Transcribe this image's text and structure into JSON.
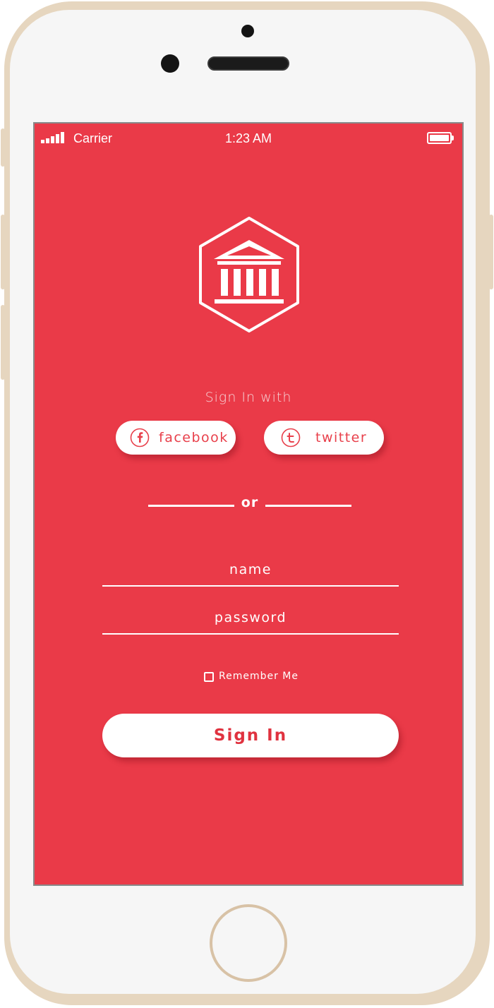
{
  "status_bar": {
    "carrier": "Carrier",
    "time": "1:23 AM",
    "signal_icon": "signal-bars-icon",
    "battery_icon": "battery-full-icon",
    "battery_level": 1.0
  },
  "logo": {
    "icon": "bank-building-hexagon-icon"
  },
  "social": {
    "heading": "Sign In with",
    "facebook_label": "facebook",
    "facebook_icon": "facebook-icon",
    "twitter_label": "twitter",
    "twitter_icon": "twitter-icon"
  },
  "divider": {
    "label": "or"
  },
  "form": {
    "name_placeholder": "name",
    "password_placeholder": "password",
    "remember_label": "Remember Me",
    "remember_checked": false,
    "submit_label": "Sign In"
  },
  "colors": {
    "background": "#ea3a48",
    "accent": "#e8404b",
    "text": "#ffffff",
    "device_frame": "#e6d6bf"
  }
}
